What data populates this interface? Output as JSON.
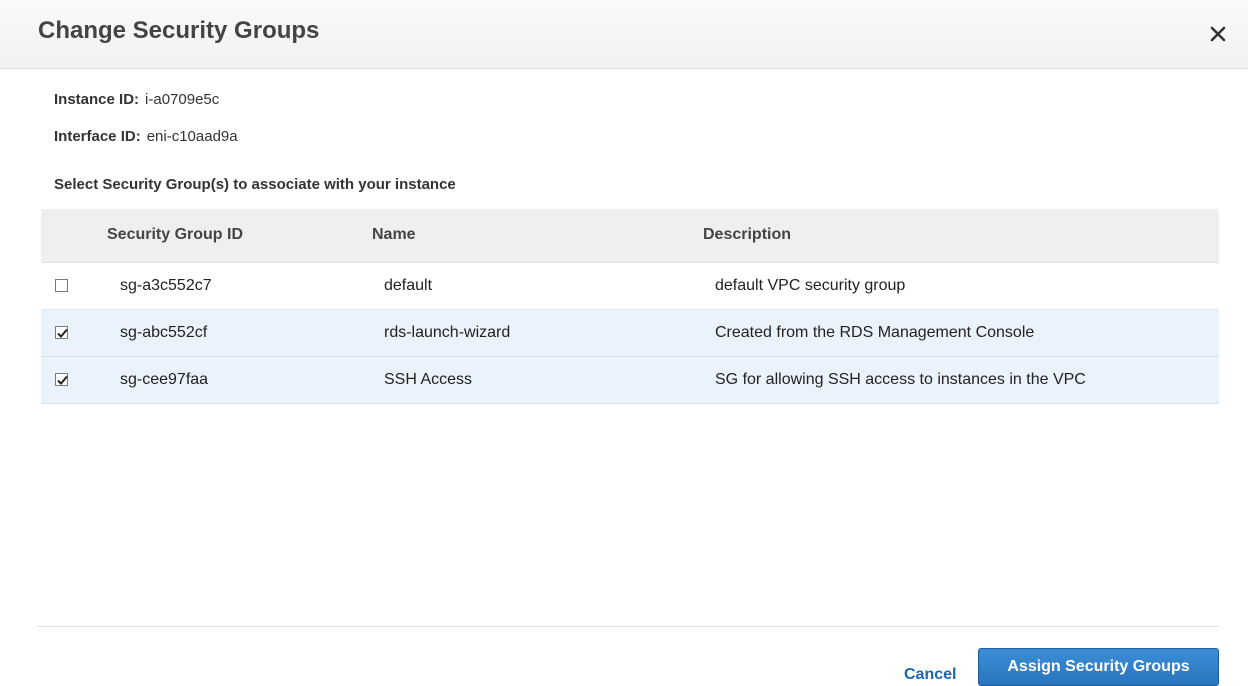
{
  "dialog": {
    "title": "Change Security Groups",
    "close_icon": "close-icon"
  },
  "info": {
    "instance_label": "Instance ID:",
    "instance_value": "i-a0709e5c",
    "interface_label": "Interface ID:",
    "interface_value": "eni-c10aad9a"
  },
  "select_heading": "Select Security Group(s) to associate with your instance",
  "table": {
    "headers": [
      "Security Group ID",
      "Name",
      "Description"
    ],
    "rows": [
      {
        "id": "sg-a3c552c7",
        "name": "default",
        "description": "default VPC security group",
        "checked": false
      },
      {
        "id": "sg-abc552cf",
        "name": "rds-launch-wizard",
        "description": "Created from the RDS Management Console",
        "checked": true
      },
      {
        "id": "sg-cee97faa",
        "name": "SSH Access",
        "description": "SG for allowing SSH access to instances in the VPC",
        "checked": true
      }
    ]
  },
  "footer": {
    "cancel_label": "Cancel",
    "assign_label": "Assign Security Groups"
  },
  "colors": {
    "primary_button": "#2a74bd",
    "link": "#1a66b3",
    "selected_row": "#eaf2fb",
    "header_bg": "#efefef"
  }
}
